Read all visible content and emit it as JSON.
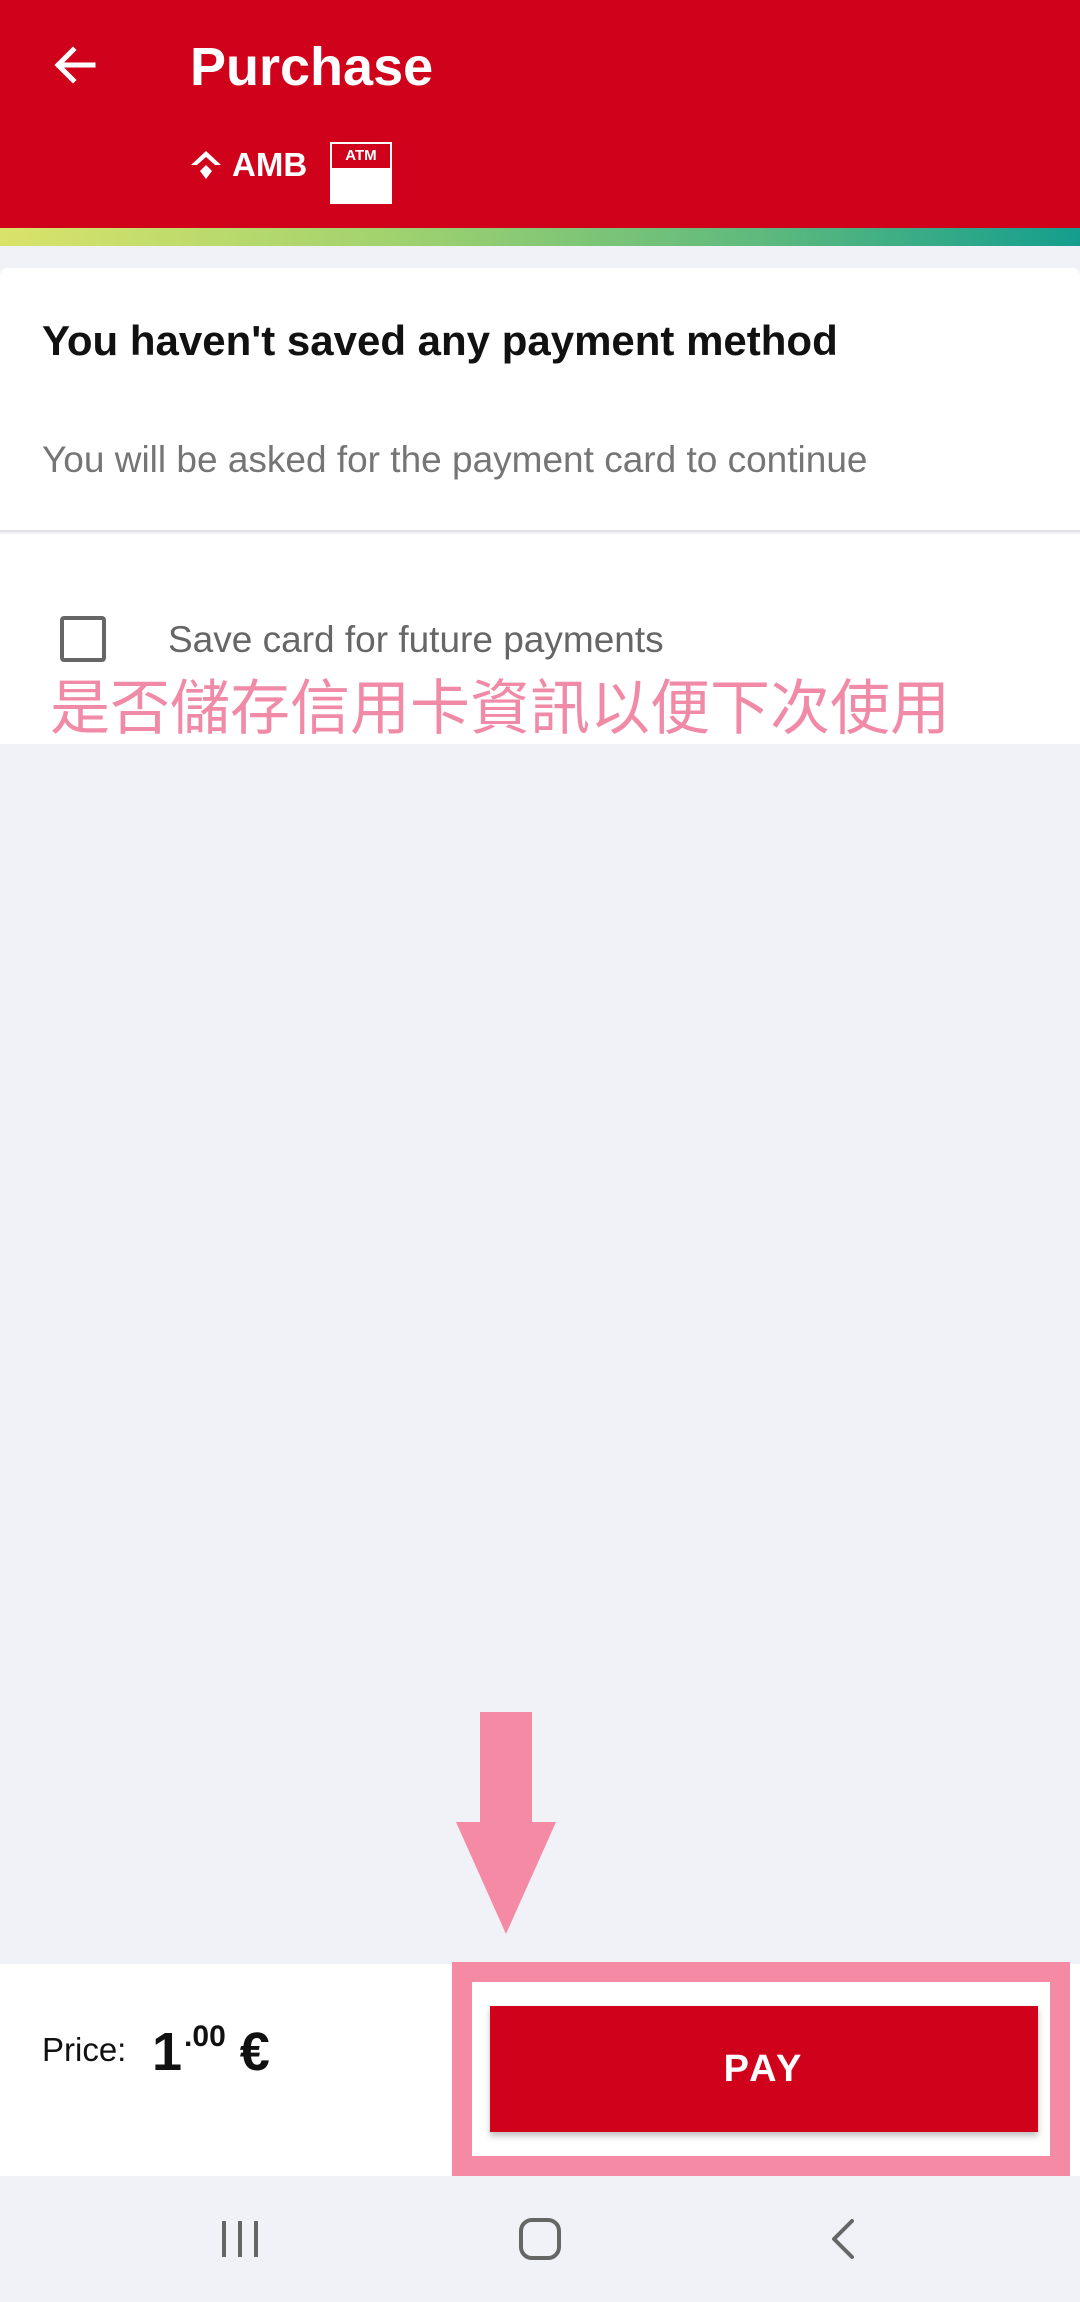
{
  "header": {
    "title": "Purchase",
    "amb_logo_text": "AMB",
    "atm_logo_text": "ATM",
    "background_color": "#d0021b"
  },
  "info": {
    "title": "You haven't saved any payment method",
    "subtitle": "You will be asked for the payment card to continue"
  },
  "save_card": {
    "label": "Save card for future payments",
    "checked": false
  },
  "annotation": {
    "text": "是否儲存信用卡資訊以便下次使用",
    "color": "#f08aa6"
  },
  "price": {
    "label": "Price:",
    "integer": "1",
    "decimal": ".00",
    "currency": "€"
  },
  "pay_button": {
    "label": "PAY",
    "color": "#d0021b"
  },
  "icons": {
    "back": "arrow-left-icon",
    "recent_apps": "recent-apps-icon",
    "home": "home-icon",
    "nav_back": "chevron-left-icon"
  }
}
